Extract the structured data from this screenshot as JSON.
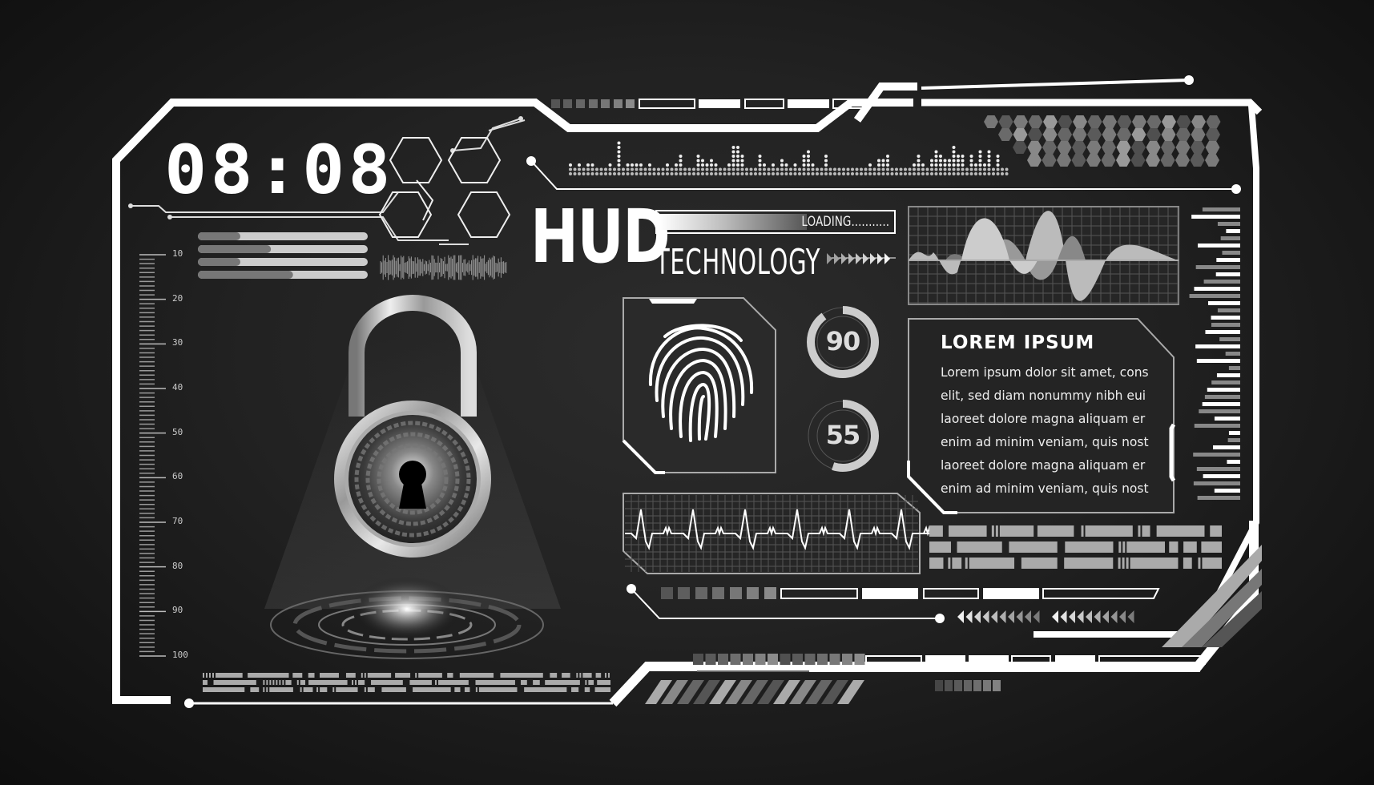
{
  "clock": {
    "time": "08:08"
  },
  "header": {
    "title": "HUD",
    "subtitle": "TECHNOLOGY",
    "loading_label": "LOADING...........",
    "loading_progress": 0.62
  },
  "info_panel": {
    "title": "LOREM IPSUM",
    "lines": [
      "Lorem ipsum dolor sit amet, cons",
      "elit, sed diam nonummy nibh eui",
      "laoreet dolore magna aliquam er",
      "enim ad minim veniam, quis nost",
      "laoreet dolore magna aliquam er",
      "enim ad minim veniam, quis nost"
    ]
  },
  "gauges": [
    {
      "label": "90",
      "value": 90
    },
    {
      "label": "55",
      "value": 55
    }
  ],
  "ruler": {
    "labels": [
      "10",
      "20",
      "30",
      "40",
      "50",
      "60",
      "70",
      "80",
      "90",
      "100"
    ]
  },
  "progress_bars": [
    0.25,
    0.43,
    0.25,
    0.56
  ],
  "icons": {
    "lock": "padlock-icon",
    "fingerprint": "fingerprint-icon",
    "wave": "waveform-chart",
    "ecg": "heartbeat-chart"
  },
  "colors": {
    "background": "#1e1e1e",
    "frame": "#ffffff",
    "accent_gray": "#aaaaaa"
  }
}
